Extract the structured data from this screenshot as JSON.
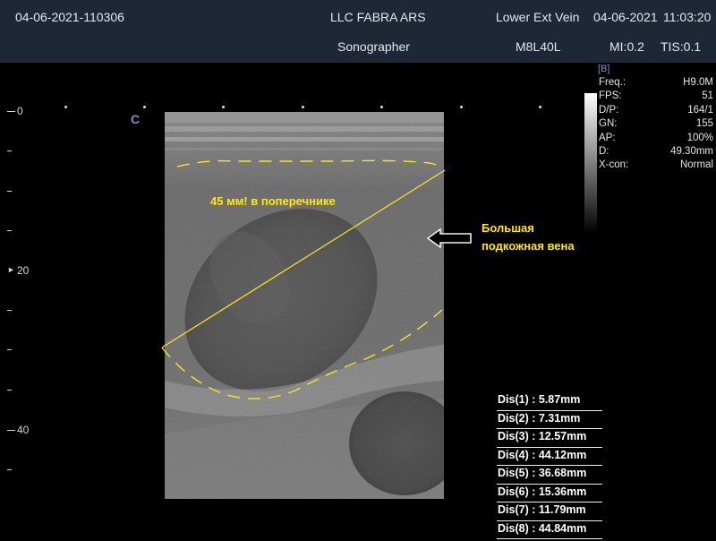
{
  "header": {
    "datetime_id": "04-06-2021-110306",
    "institution": "LLC FABRA ARS",
    "exam": "Lower Ext Vein",
    "date": "04-06-2021",
    "time": "11:03:20",
    "operator": "Sonographer",
    "probe": "M8L40L",
    "mi": "MI:0.2",
    "tis": "TIS:0.1"
  },
  "depth_scale": {
    "labels": [
      "0",
      "20",
      "40"
    ]
  },
  "probe_orientation_mark": "C",
  "params": {
    "mode": "[B]",
    "rows": [
      {
        "key": "Freq.:",
        "value": "H9.0M"
      },
      {
        "key": "FPS:",
        "value": "51"
      },
      {
        "key": "D/P:",
        "value": "164/1"
      },
      {
        "key": "GN:",
        "value": "155"
      },
      {
        "key": "AP:",
        "value": "100%"
      },
      {
        "key": "D:",
        "value": "49.30mm"
      },
      {
        "key": "X-con:",
        "value": "Normal"
      }
    ]
  },
  "annotations": {
    "measure_caption": "45 мм! в поперечнике",
    "vein_caption_line1": "Большая",
    "vein_caption_line2": "подкожная вена"
  },
  "measurements": [
    "Dis(1) : 5.87mm",
    "Dis(2) : 7.31mm",
    "Dis(3) : 12.57mm",
    "Dis(4) : 44.12mm",
    "Dis(5) : 36.68mm",
    "Dis(6) : 15.36mm",
    "Dis(7) : 11.79mm",
    "Dis(8) : 44.84mm"
  ],
  "colors": {
    "header_bg": "#1e2735",
    "annotation_yellow": "#ffe619",
    "mode_blue": "#7d8fd0"
  }
}
